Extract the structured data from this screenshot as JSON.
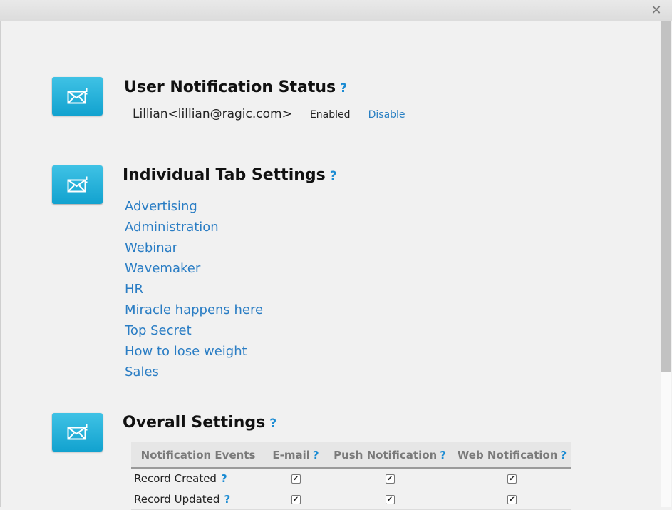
{
  "window": {
    "close_icon": "close-icon",
    "close_glyph": "✕"
  },
  "sections": {
    "user_status": {
      "title": "User Notification Status",
      "help": "?",
      "user": "Lillian<lillian@ragic.com>",
      "state": "Enabled",
      "action": "Disable"
    },
    "tab_settings": {
      "title": "Individual Tab Settings",
      "help": "?",
      "tabs": [
        "Advertising",
        "Administration",
        "Webinar",
        "Wavemaker",
        "HR",
        "Miracle happens here",
        "Top Secret",
        "How to lose weight",
        "Sales"
      ]
    },
    "overall": {
      "title": "Overall Settings",
      "help": "?",
      "columns": [
        "Notification Events",
        "E-mail",
        "Push Notification",
        "Web Notification"
      ],
      "column_help": [
        "",
        "?",
        "?",
        "?"
      ],
      "rows": [
        {
          "event": "Record Created",
          "help": "?",
          "email": true,
          "push": true,
          "web": true
        },
        {
          "event": "Record Updated",
          "help": "?",
          "email": true,
          "push": true,
          "web": true
        }
      ]
    }
  },
  "colors": {
    "accent": "#1a8bd3",
    "link": "#2a7dc4",
    "icon_tile": "#1ba9d6"
  }
}
